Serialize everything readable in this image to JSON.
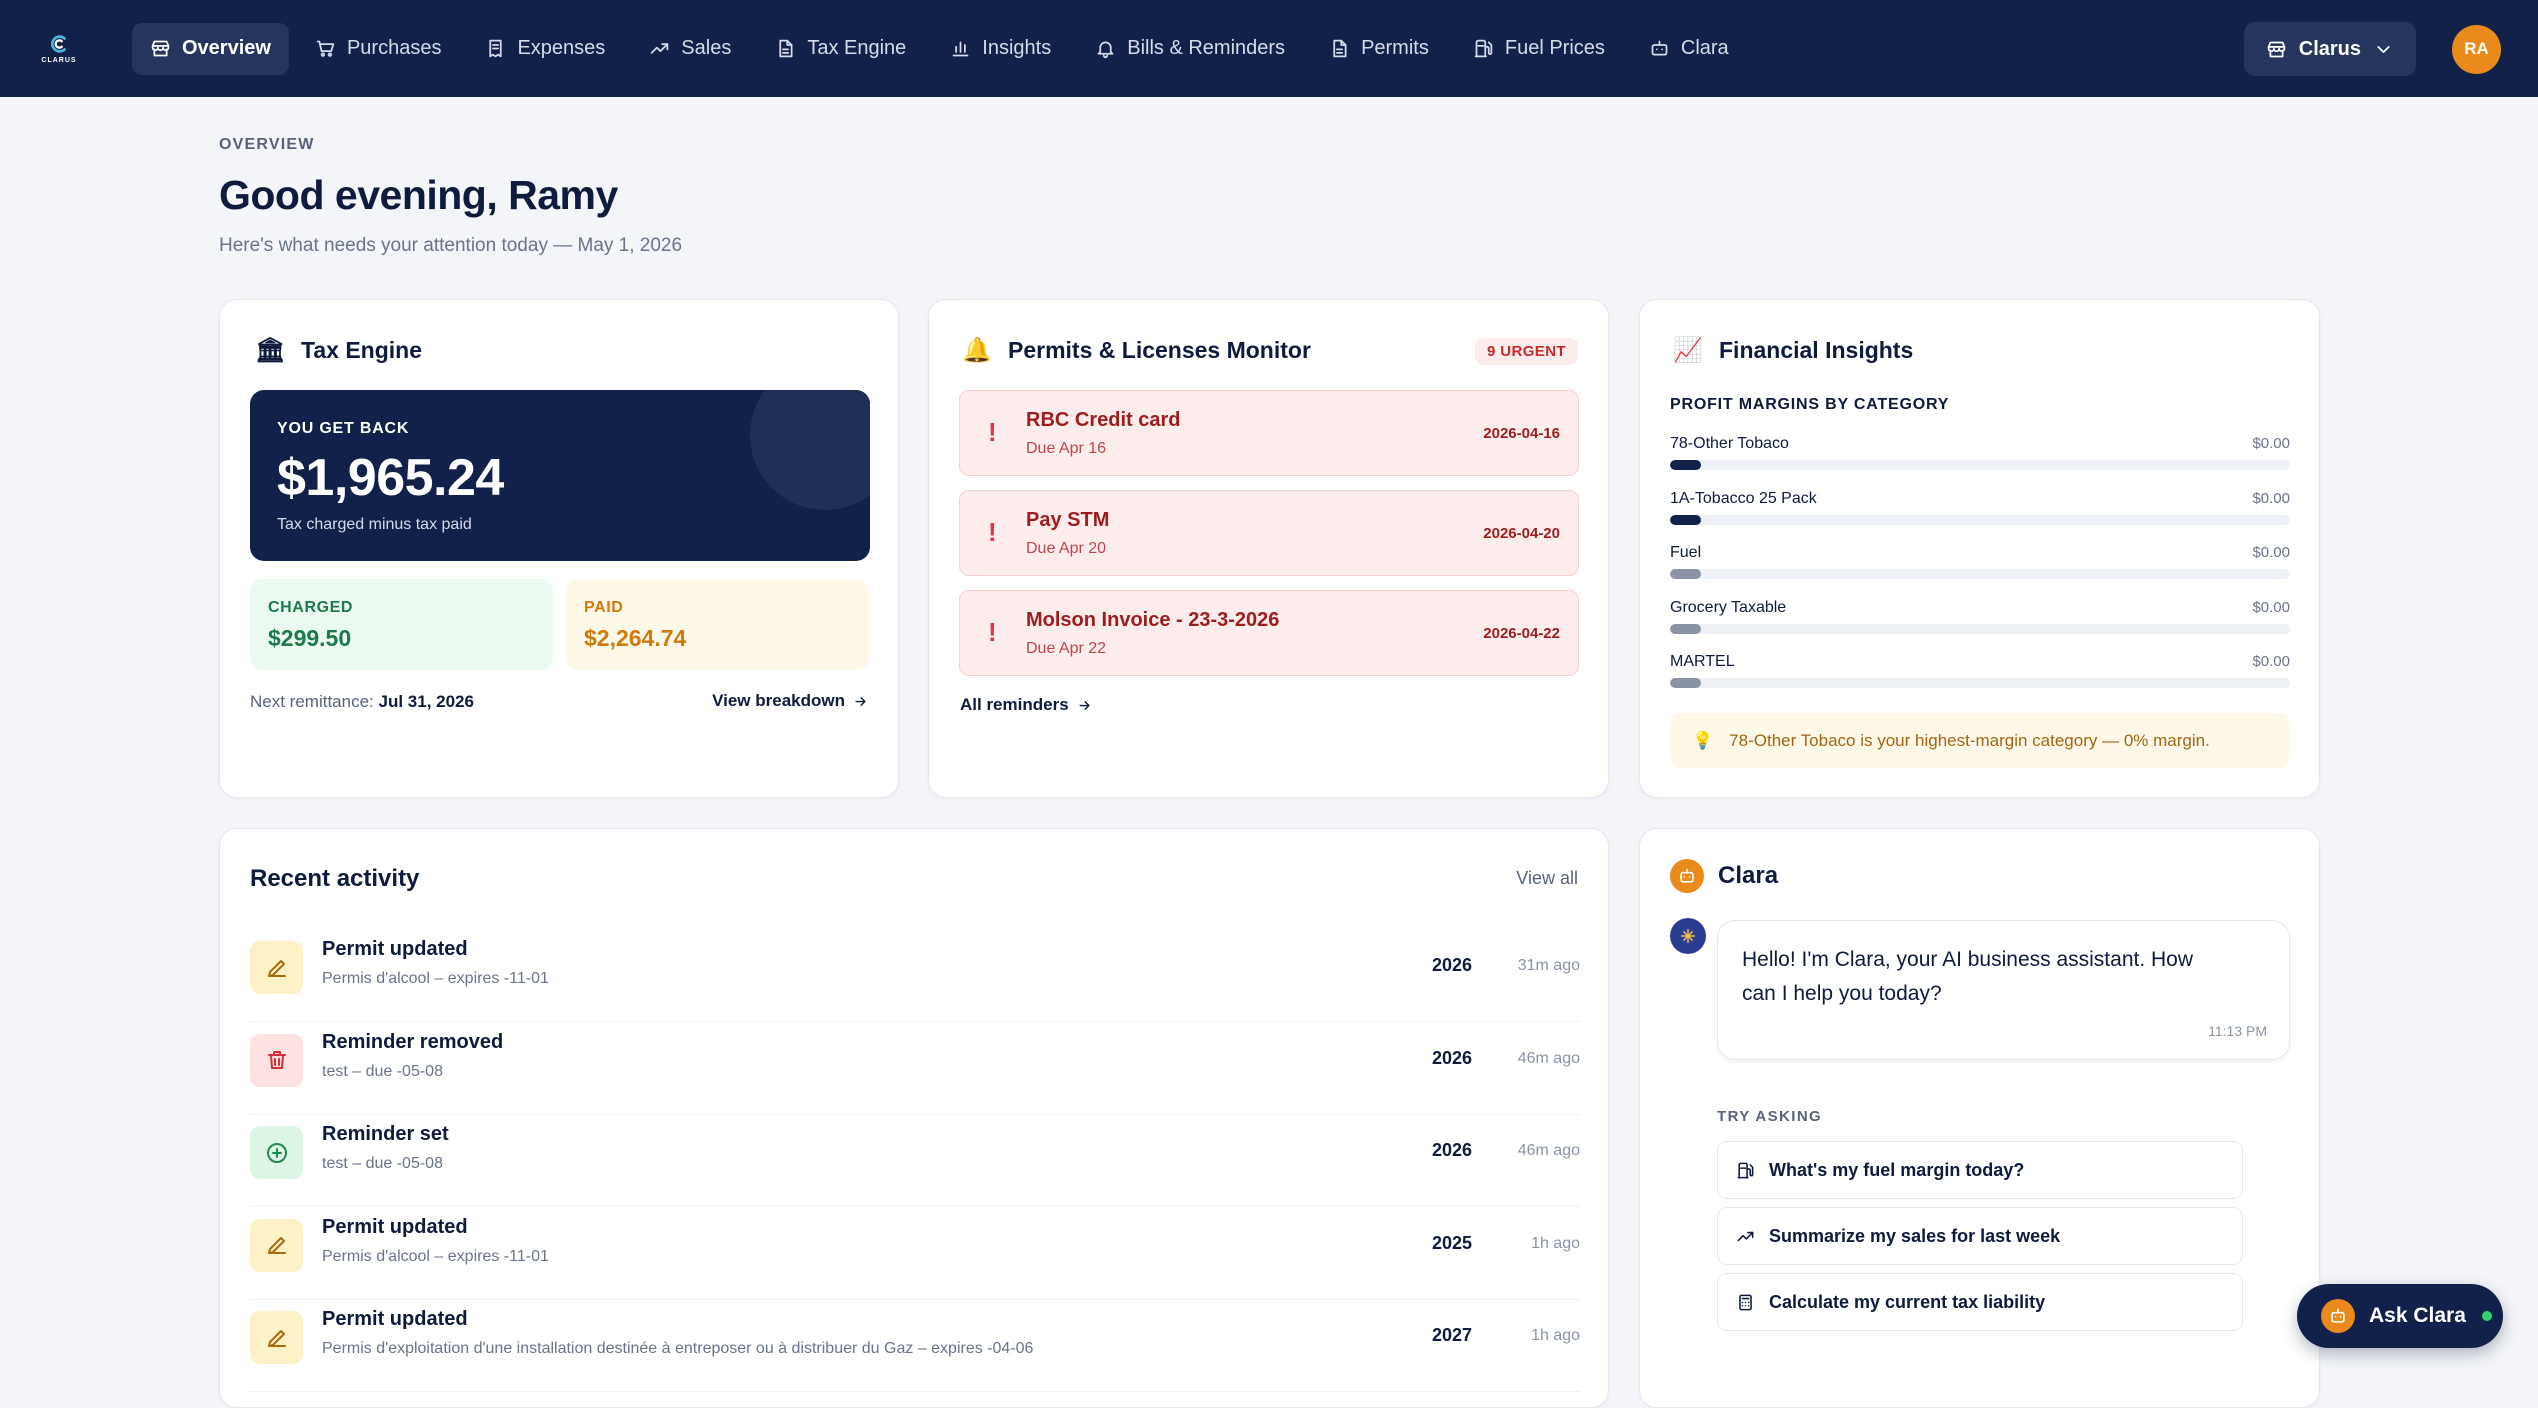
{
  "brand": {
    "name": "CLARUS"
  },
  "nav": {
    "items": [
      {
        "label": "Overview",
        "icon": "store-icon",
        "active": true
      },
      {
        "label": "Purchases",
        "icon": "cart-icon"
      },
      {
        "label": "Expenses",
        "icon": "receipt-icon"
      },
      {
        "label": "Sales",
        "icon": "trend-up-icon"
      },
      {
        "label": "Tax Engine",
        "icon": "document-icon"
      },
      {
        "label": "Insights",
        "icon": "bar-chart-icon"
      },
      {
        "label": "Bills & Reminders",
        "icon": "bell-icon"
      },
      {
        "label": "Permits",
        "icon": "document-icon"
      },
      {
        "label": "Fuel Prices",
        "icon": "fuel-icon"
      },
      {
        "label": "Clara",
        "icon": "bot-icon"
      }
    ],
    "store": "Clarus",
    "avatar": "RA"
  },
  "header": {
    "eyebrow": "OVERVIEW",
    "greeting": "Good evening, Ramy",
    "subtitle": "Here's what needs your attention today — May 1, 2026"
  },
  "tax": {
    "title": "Tax Engine",
    "getback_label": "YOU GET BACK",
    "getback_amount": "$1,965.24",
    "getback_sub": "Tax charged minus tax paid",
    "charged_label": "CHARGED",
    "charged_value": "$299.50",
    "paid_label": "PAID",
    "paid_value": "$2,264.74",
    "remit_label": "Next remittance:",
    "remit_date": "Jul 31, 2026",
    "link": "View breakdown"
  },
  "permits": {
    "title": "Permits & Licenses Monitor",
    "badge": "9 URGENT",
    "items": [
      {
        "title": "RBC Credit card",
        "due": "Due Apr 16",
        "date": "2026-04-16"
      },
      {
        "title": "Pay STM",
        "due": "Due Apr 20",
        "date": "2026-04-20"
      },
      {
        "title": "Molson Invoice - 23-3-2026",
        "due": "Due Apr 22",
        "date": "2026-04-22"
      }
    ],
    "link": "All reminders"
  },
  "insights": {
    "title": "Financial Insights",
    "section": "PROFIT MARGINS BY CATEGORY",
    "rows": [
      {
        "name": "78-Other Tobaco",
        "value": "$0.00",
        "color": "#112149"
      },
      {
        "name": "1A-Tobacco 25 Pack",
        "value": "$0.00",
        "color": "#112149"
      },
      {
        "name": "Fuel",
        "value": "$0.00",
        "color": "#8a93a6"
      },
      {
        "name": "Grocery Taxable",
        "value": "$0.00",
        "color": "#8a93a6"
      },
      {
        "name": "MARTEL",
        "value": "$0.00",
        "color": "#8a93a6"
      }
    ],
    "tip": "78-Other Tobaco is your highest-margin category — 0% margin."
  },
  "activity": {
    "title": "Recent activity",
    "view_all": "View all",
    "items": [
      {
        "title": "Permit updated",
        "desc": "Permis d'alcool – expires -11-01",
        "year": "2026",
        "ago": "31m ago",
        "kind": "yellow"
      },
      {
        "title": "Reminder removed",
        "desc": "test – due -05-08",
        "year": "2026",
        "ago": "46m ago",
        "kind": "red"
      },
      {
        "title": "Reminder set",
        "desc": "test – due -05-08",
        "year": "2026",
        "ago": "46m ago",
        "kind": "green"
      },
      {
        "title": "Permit updated",
        "desc": "Permis d'alcool – expires -11-01",
        "year": "2025",
        "ago": "1h ago",
        "kind": "yellow"
      },
      {
        "title": "Permit updated",
        "desc": "Permis d'exploitation d'une installation destinée à entreposer ou à distribuer du Gaz – expires -04-06",
        "year": "2027",
        "ago": "1h ago",
        "kind": "yellow"
      }
    ]
  },
  "clara": {
    "title": "Clara",
    "message": "Hello! I'm Clara, your AI business assistant. How can I help you today?",
    "time": "11:13 PM",
    "try_label": "TRY ASKING",
    "suggestions": [
      {
        "label": "What's my fuel margin today?",
        "icon": "fuel-icon"
      },
      {
        "label": "Summarize my sales for last week",
        "icon": "trend-up-icon"
      },
      {
        "label": "Calculate my current tax liability",
        "icon": "calculator-icon"
      }
    ]
  },
  "ask_clara": "Ask Clara"
}
